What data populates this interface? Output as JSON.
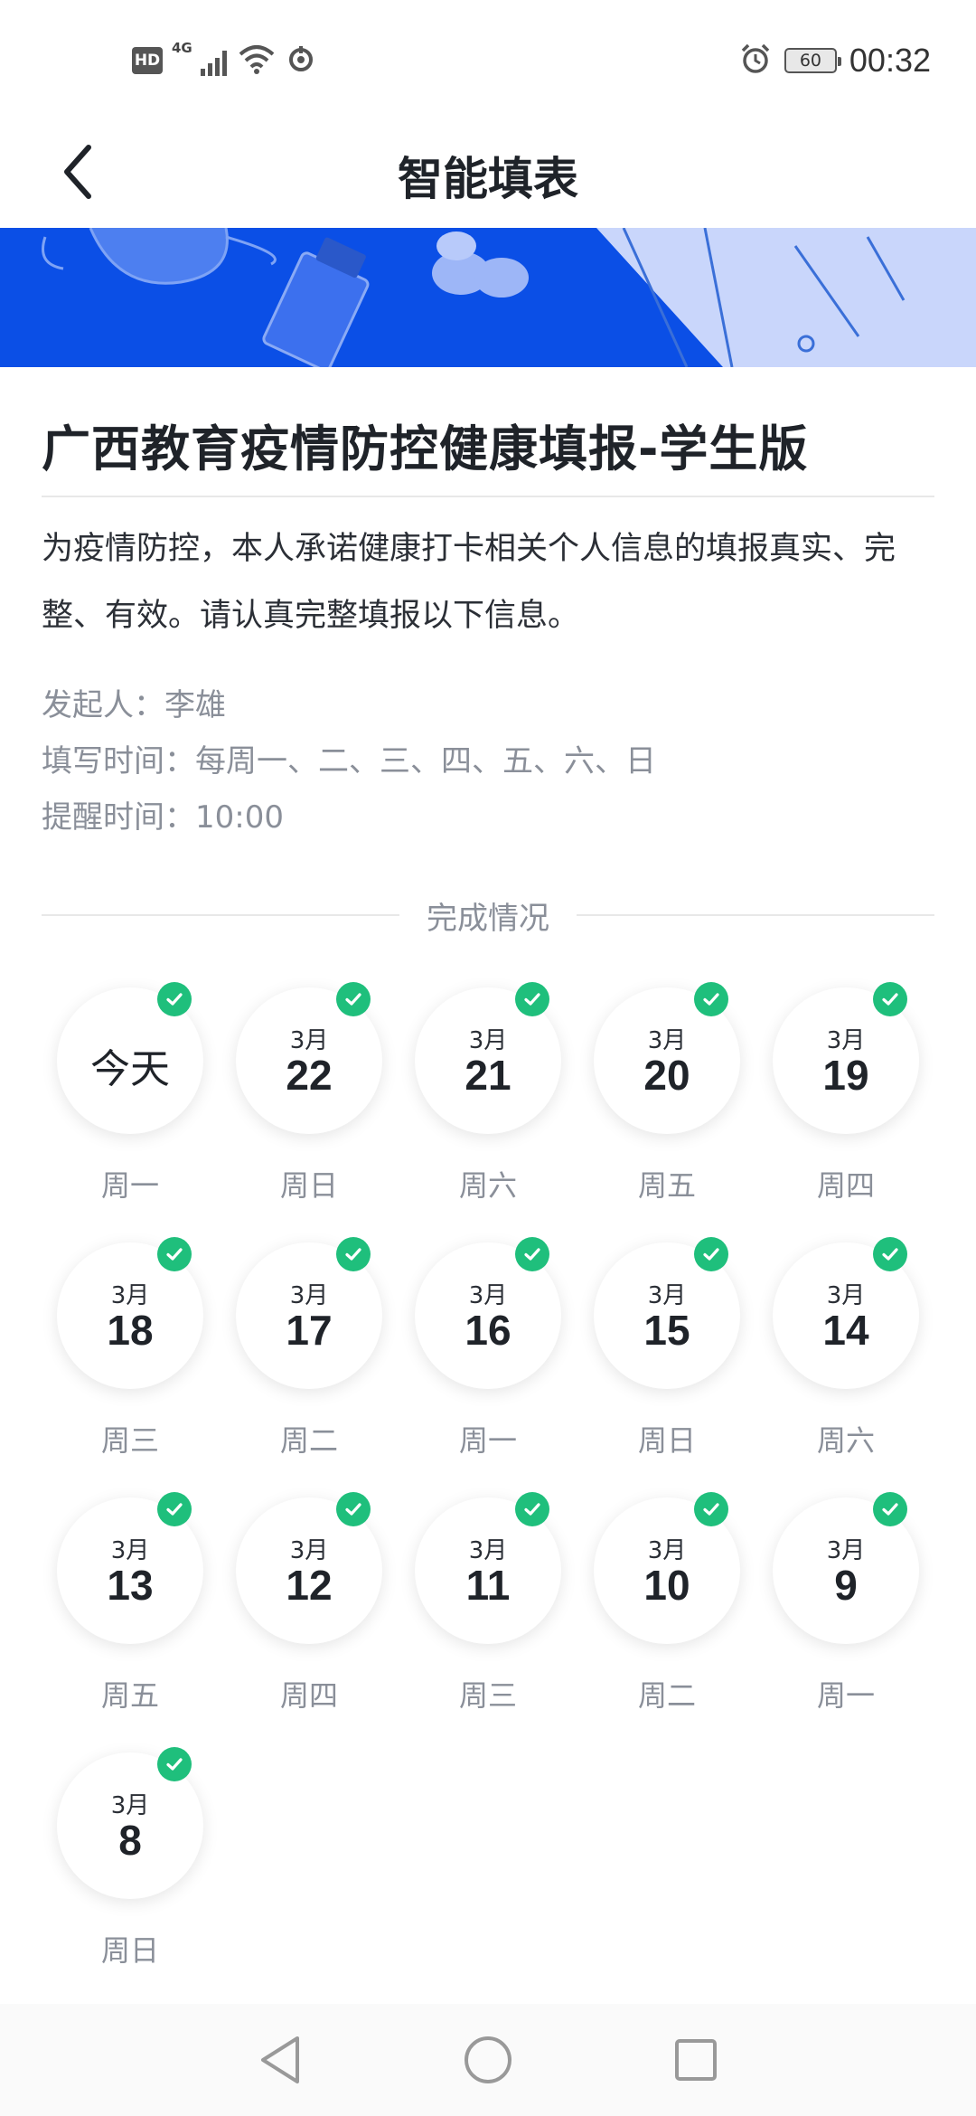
{
  "status_bar": {
    "hd_label": "HD",
    "network_label": "4G",
    "time": "00:32",
    "battery": "60"
  },
  "header": {
    "title": "智能填表"
  },
  "form": {
    "title": "广西教育疫情防控健康填报-学生版",
    "description": "为疫情防控，本人承诺健康打卡相关个人信息的填报真实、完整、有效。请认真完整填报以下信息。",
    "initiator_label": "发起人：",
    "initiator": "李雄",
    "fill_time_label": "填写时间：",
    "fill_time": "每周一、二、三、四、五、六、日",
    "reminder_label": "提醒时间：",
    "reminder": "10:00"
  },
  "completion": {
    "section_label": "完成情况",
    "days": [
      {
        "month": "",
        "date": "今天",
        "weekday": "周一",
        "done": true
      },
      {
        "month": "3月",
        "date": "22",
        "weekday": "周日",
        "done": true
      },
      {
        "month": "3月",
        "date": "21",
        "weekday": "周六",
        "done": true
      },
      {
        "month": "3月",
        "date": "20",
        "weekday": "周五",
        "done": true
      },
      {
        "month": "3月",
        "date": "19",
        "weekday": "周四",
        "done": true
      },
      {
        "month": "3月",
        "date": "18",
        "weekday": "周三",
        "done": true
      },
      {
        "month": "3月",
        "date": "17",
        "weekday": "周二",
        "done": true
      },
      {
        "month": "3月",
        "date": "16",
        "weekday": "周一",
        "done": true
      },
      {
        "month": "3月",
        "date": "15",
        "weekday": "周日",
        "done": true
      },
      {
        "month": "3月",
        "date": "14",
        "weekday": "周六",
        "done": true
      },
      {
        "month": "3月",
        "date": "13",
        "weekday": "周五",
        "done": true
      },
      {
        "month": "3月",
        "date": "12",
        "weekday": "周四",
        "done": true
      },
      {
        "month": "3月",
        "date": "11",
        "weekday": "周三",
        "done": true
      },
      {
        "month": "3月",
        "date": "10",
        "weekday": "周二",
        "done": true
      },
      {
        "month": "3月",
        "date": "9",
        "weekday": "周一",
        "done": true
      },
      {
        "month": "3月",
        "date": "8",
        "weekday": "周日",
        "done": true
      }
    ]
  },
  "colors": {
    "accent_green": "#1fbf7c",
    "banner_blue": "#0b4fe6"
  }
}
